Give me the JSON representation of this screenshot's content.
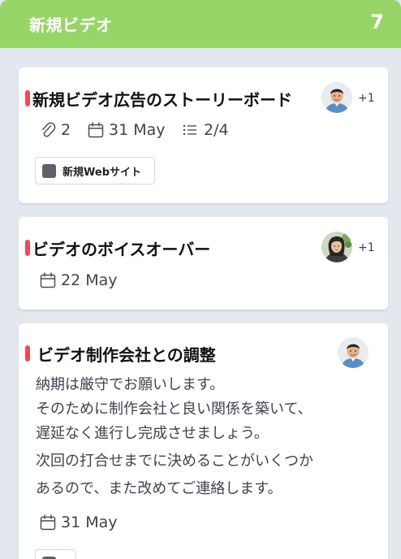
{
  "column": {
    "title": "新規ビデオ",
    "count": "7",
    "header_color": "#98d568"
  },
  "priority_color": "#ee4b57",
  "cards": [
    {
      "title": "新規ビデオ広告のストーリーボード",
      "extra_assignees": "+1",
      "attachments": "2",
      "due_date": "31 May",
      "checklist": "2/4",
      "tag": {
        "label": "新規Webサイト",
        "color": "#5f6168"
      }
    },
    {
      "title": "ビデオのボイスオーバー",
      "extra_assignees": "+1",
      "due_date": "22 May"
    },
    {
      "title": "ビデオ制作会社との調整",
      "description": [
        "納期は厳守でお願いします。",
        "そのために制作会社と良い関係を築いて、",
        "遅延なく進行し完成させましょう。",
        "次回の打合せまでに決めることがいくつか",
        "あるので、また改めてご連絡します。"
      ],
      "due_date": "31 May"
    }
  ],
  "icons": {
    "attachment": "paperclip-icon",
    "due_date": "calendar-icon",
    "checklist": "checklist-icon"
  }
}
